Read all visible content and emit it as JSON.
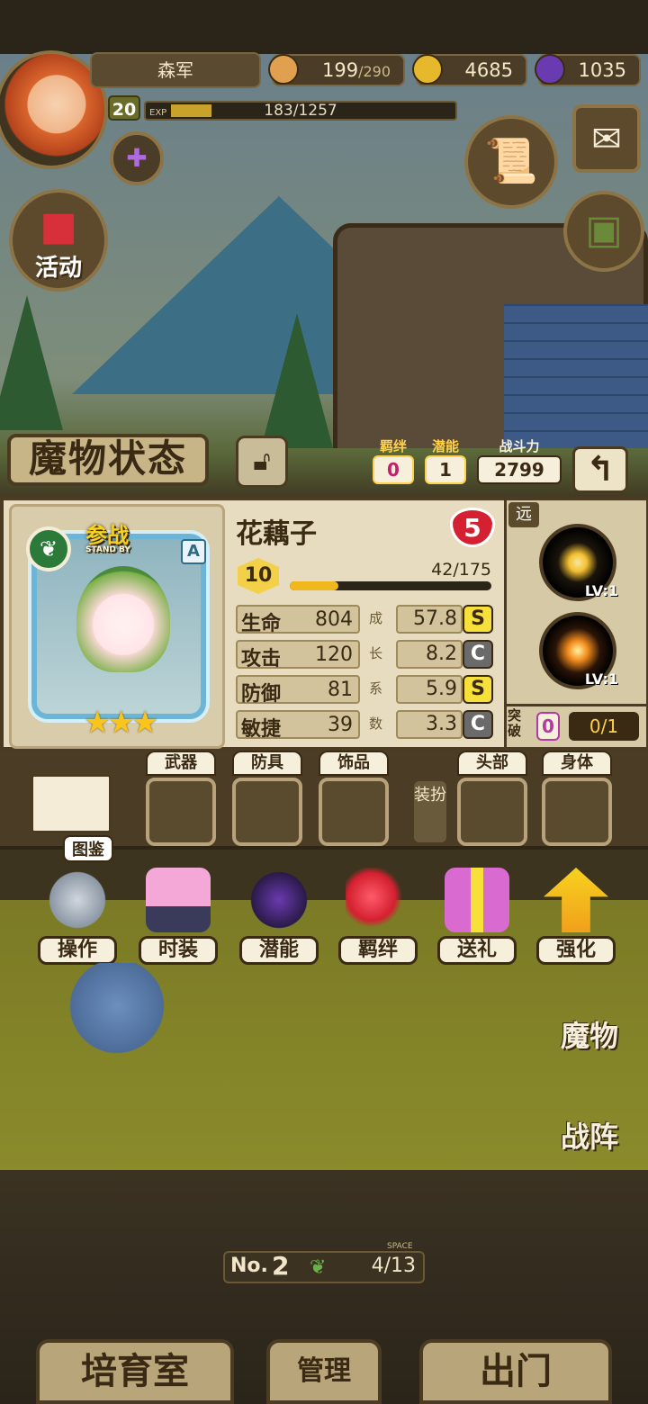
{
  "player": {
    "name": "森军",
    "level": "20",
    "exp_label": "EXP",
    "exp_text": "183/1257",
    "exp_progress": 0.146
  },
  "resources": {
    "stamina_value": "199",
    "stamina_max": "/290",
    "gold": "4685",
    "gems": "1035"
  },
  "left_buttons": {
    "activity_label": "活动"
  },
  "header": {
    "title": "魔物状态",
    "bond_label": "羁绊",
    "bond_value": "0",
    "potential_label": "潜能",
    "potential_value": "1",
    "power_label": "战斗力",
    "power_value": "2799",
    "back_icon": "back-arrow-icon"
  },
  "monster": {
    "name": "花藕子",
    "standby": "参战",
    "standby_sub": "STAND BY",
    "rank": "A",
    "stars": "★★★",
    "heart_level": "5",
    "level": "10",
    "exp_text": "42/175",
    "exp_progress": 0.24,
    "growth_chars": [
      "成",
      "长",
      "系",
      "数"
    ],
    "stats": [
      {
        "name": "生命",
        "value": "804",
        "growth": "57.8",
        "grade": "S"
      },
      {
        "name": "攻击",
        "value": "120",
        "growth": "8.2",
        "grade": "C"
      },
      {
        "name": "防御",
        "value": "81",
        "growth": "5.9",
        "grade": "S"
      },
      {
        "name": "敏捷",
        "value": "39",
        "growth": "3.3",
        "grade": "C"
      }
    ]
  },
  "skills": {
    "range": "远",
    "skill1_lv": "LV:1",
    "skill2_lv": "LV:1",
    "break_label": "突破",
    "break_count": "0",
    "break_progress": "0/1"
  },
  "equipment": {
    "book_label": "图鉴",
    "swap_label": "装扮",
    "slots": [
      "武器",
      "防具",
      "饰品",
      "头部",
      "身体"
    ]
  },
  "menu": [
    "操作",
    "时装",
    "潜能",
    "羁绊",
    "送礼",
    "强化"
  ],
  "field": {
    "monster_text": "蓝色史莱姆",
    "side_monster": "魔物",
    "side_formation": "战阵"
  },
  "bottom": {
    "no_label": "No.",
    "no_value": "2",
    "space_label": "SPACE",
    "space_value": "4/13",
    "breed": "培育室",
    "manage": "管理",
    "go_out": "出门"
  },
  "colors": {
    "panel_bg": "#e7dcbf",
    "accent_gold": "#ffd04a",
    "heart_red": "#d42030",
    "grade_s": "#f7e03a"
  }
}
